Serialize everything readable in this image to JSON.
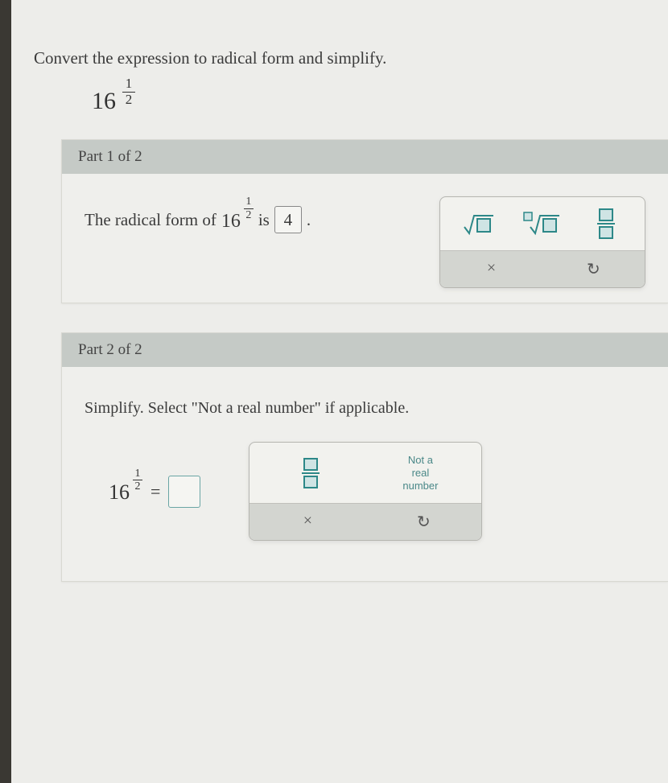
{
  "prompt": "Convert the expression to radical form and simplify.",
  "expression": {
    "base": "16",
    "num": "1",
    "den": "2"
  },
  "part1": {
    "header": "Part 1 of 2",
    "text_prefix": "The radical form of ",
    "text_mid": " is ",
    "answer": "4",
    "period": "."
  },
  "part2": {
    "header": "Part 2 of 2",
    "instruction": "Simplify. Select \"Not a real number\" if applicable.",
    "equals": "="
  },
  "toolbox": {
    "not_real_l1": "Not a",
    "not_real_l2": "real",
    "not_real_l3": "number",
    "clear": "×",
    "undo": "↺"
  }
}
